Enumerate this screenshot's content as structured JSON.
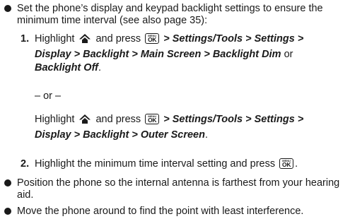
{
  "bullets": [
    {
      "line1": "Set the phone’s display and keypad backlight settings to ensure the",
      "line2": "minimum time interval (see also page 35):"
    },
    {
      "line1": "Position the phone so the internal antenna is farthest from your hearing",
      "line2": "aid."
    },
    {
      "line1": "Move the phone around to find the point with least interference."
    }
  ],
  "step1": {
    "number": "1.",
    "highlight": "Highlight",
    "and_press": "and press",
    "path_a1": "> Settings/Tools > Settings >",
    "path_a2": "Display > Backlight > Main Screen > Backlight Dim",
    "or_word": "or",
    "path_a3": "Backlight Off",
    "period": ".",
    "or_separator": "– or –",
    "path_b1": "> Settings/Tools > Settings >",
    "path_b2": "Display > Backlight > Outer Screen",
    "period_b": "."
  },
  "step2": {
    "number": "2.",
    "text": "Highlight the minimum time interval setting and press",
    "period": "."
  },
  "ok_key": {
    "menu": "MENU",
    "ok": "OK"
  },
  "icons": {
    "home": "home-icon",
    "ok_key": "menu-ok-key-icon"
  }
}
